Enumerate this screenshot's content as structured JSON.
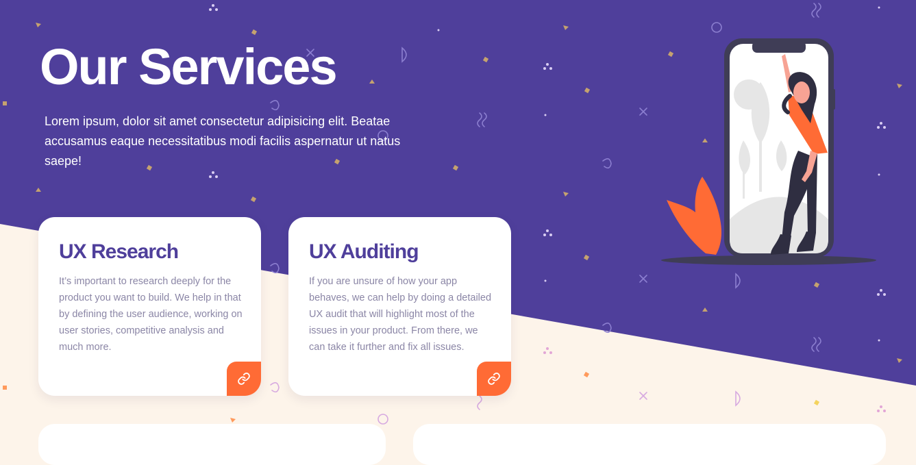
{
  "hero": {
    "title": "Our Services",
    "description": "Lorem ipsum, dolor sit amet consectetur adipisicing elit. Beatae accusamus eaque necessitatibus modi facilis aspernatur ut natus saepe!"
  },
  "services": [
    {
      "title": "UX Research",
      "text": "It’s important to research deeply for the product you want to build. We help in that by defining the user audience, working on user stories, competitive analysis and much more.",
      "link_icon": "link-icon"
    },
    {
      "title": "UX Auditing",
      "text": "If you are unsure of how your app behaves, we can help by doing a detailed UX audit that will highlight most of the issues in your product. From there, we can take it further and fix all issues.",
      "link_icon": "link-icon"
    }
  ],
  "colors": {
    "hero_background": "#4f3f9b",
    "page_background": "#fdf4ea",
    "accent": "#ff6b35",
    "card_title": "#4f3f9b",
    "card_text": "#8b86a6"
  }
}
